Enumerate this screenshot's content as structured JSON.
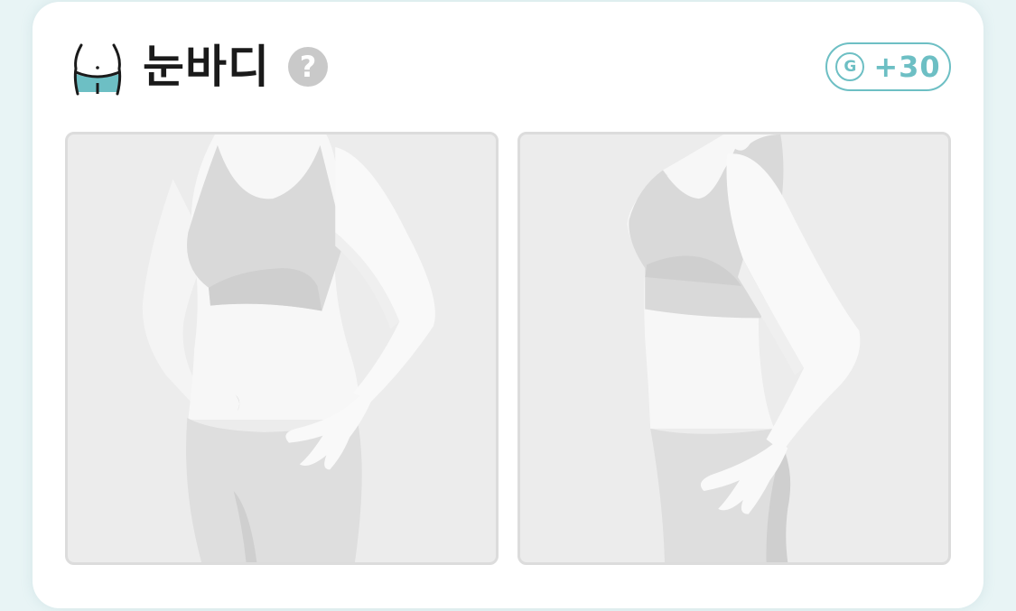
{
  "header": {
    "icon": "waist-icon",
    "title": "눈바디",
    "help_icon": "question-icon",
    "help_label": "?"
  },
  "points": {
    "icon": "g-coin-icon",
    "icon_label": "G",
    "value": "+30"
  },
  "photos": [
    {
      "name": "photo-slot-front",
      "icon": "front-body-silhouette"
    },
    {
      "name": "photo-slot-side",
      "icon": "side-body-silhouette"
    }
  ],
  "colors": {
    "accent": "#6dbfc4",
    "background": "#e8f4f5",
    "card": "#ffffff",
    "placeholder": "#ececec",
    "help": "#c9c9c9"
  }
}
